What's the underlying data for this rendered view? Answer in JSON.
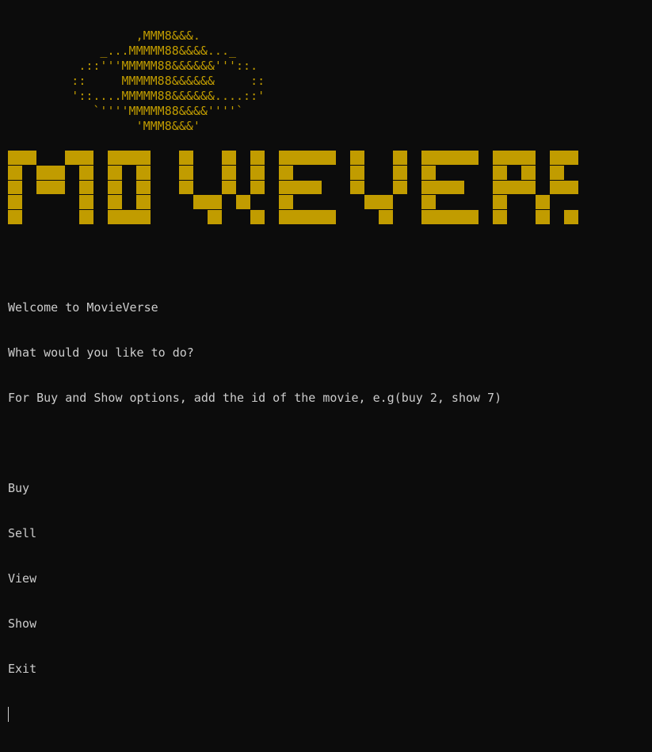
{
  "terminal": {
    "logo_art": "                   ,MMM8&&&.\n              _...MMMMM88&&&&..._\n           .::'''MMMMM88&&&&&&'''::.\n          ::     MMMMM88&&&&&&     ::\n          '::....MMMMM88&&&&&&....::'\n             `''''MMMMM88&&&&''''`\n                   'MMM8&&&'",
    "banner_title": "MOVIEVERSE",
    "banner_grid": [
      "##  ## ###  #  # # #### #  # #### ### ####",
      "# ## # # #  #  # # #    #  # #    # # #   ",
      "# ## # # #  #  # # ###  #  # ###  ### ####",
      "#    # # #   ## #  #     ##  #    #  #   #",
      "#    # ###    #  # ####   #  #### #  # ####"
    ],
    "lines": [
      "Welcome to MovieVerse",
      "What would you like to do?",
      "For Buy and Show options, add the id of the movie, e.g(buy 2, show 7)",
      "",
      "Buy",
      "Sell",
      "View",
      "Show",
      "Exit"
    ],
    "colors": {
      "background": "#0c0c0c",
      "text": "#cccccc",
      "accent": "#c19c00"
    }
  }
}
